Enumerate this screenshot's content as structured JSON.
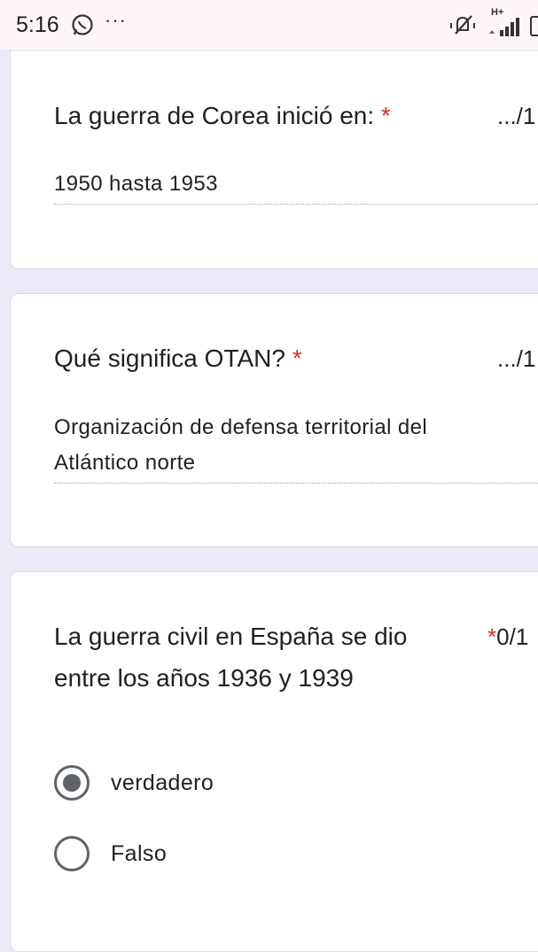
{
  "status_bar": {
    "time": "5:16",
    "dots": "···",
    "network_type": "H+",
    "icons": [
      "whatsapp-icon",
      "mute-icon",
      "signal-icon",
      "battery-icon"
    ]
  },
  "questions": [
    {
      "title": "La guerra de Corea inició en:",
      "required_mark": "*",
      "score": ".../1",
      "answer": "1950 hasta 1953"
    },
    {
      "title": "Qué significa OTAN?",
      "required_mark": "*",
      "score": ".../1",
      "answer_line1": "Organización de defensa territorial del",
      "answer_line2": "Atlántico norte"
    },
    {
      "title_line1": "La guerra civil en España se dio",
      "title_line2": "entre los años 1936 y 1939",
      "required_mark": "*",
      "score": "0/1",
      "options": [
        {
          "label": "verdadero",
          "selected": true
        },
        {
          "label": "Falso",
          "selected": false
        }
      ]
    }
  ],
  "colors": {
    "background": "#ede9f6",
    "card": "#ffffff",
    "required": "#d93025",
    "radio": "#5f6368"
  }
}
